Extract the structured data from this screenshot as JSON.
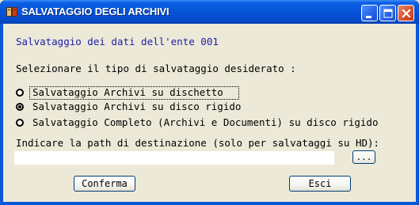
{
  "window": {
    "title": "SALVATAGGIO DEGLI ARCHIVI",
    "icon": "app-icon",
    "controls": {
      "minimize": "minimize-icon",
      "maximize": "maximize-icon",
      "close": "close-icon"
    }
  },
  "header": "Salvataggio dei dati dell'ente 001",
  "prompt": "Selezionare il tipo di salvataggio desiderato :",
  "options": [
    {
      "label": "Salvataggio Archivi su dischetto",
      "selected": false,
      "focused": true
    },
    {
      "label": "Salvataggio Archivi su disco rigido",
      "selected": true,
      "focused": false
    },
    {
      "label": "Salvataggio Completo (Archivi e Documenti) su disco rigido",
      "selected": false,
      "focused": false
    }
  ],
  "path": {
    "label": "Indicare la path di destinazione (solo per salvataggi su HD):",
    "value": "",
    "browse_label": "..."
  },
  "buttons": {
    "confirm": "Conferma",
    "exit": "Esci"
  },
  "colors": {
    "titlebar": "#0553d8",
    "background": "#ece9d8",
    "header_text": "#1c1ca6",
    "close_button": "#d4502c"
  }
}
